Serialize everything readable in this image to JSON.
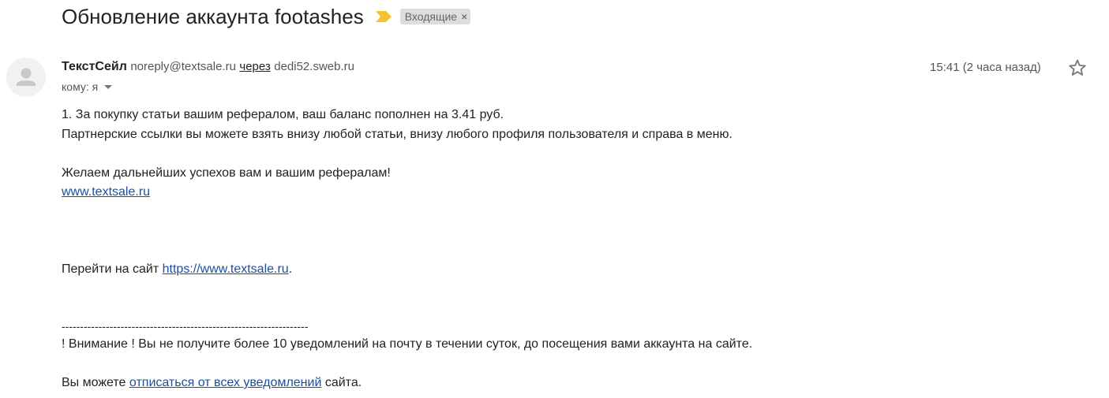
{
  "email": {
    "subject": "Обновление аккаунта footashes",
    "label": "Входящие",
    "label_close": "×",
    "sender": {
      "name": "ТекстСейл",
      "email": "noreply@textsale.ru",
      "via_label": "через",
      "via_host": "dedi52.sweb.ru"
    },
    "to_label": "кому: я",
    "time": "15:41 (2 часа назад)",
    "body": {
      "line1": "1. За покупку статьи вашим рефералом, ваш баланс пополнен на 3.41 руб.",
      "line2": "Партнерские ссылки вы можете взять внизу любой статьи, внизу любого профиля пользователя и справа в меню.",
      "line3": "Желаем дальнейших успехов вам и вашим рефералам!",
      "link1": "www.textsale.ru",
      "goto_prefix": "Перейти на сайт ",
      "goto_link": "https://www.textsale.ru",
      "goto_suffix": ".",
      "separator": "-------------------------------------------------------------------",
      "warning": "! Внимание ! Вы не получите более 10 уведомлений на почту в течении суток, до посещения вами аккаунта на сайте.",
      "unsub_prefix": "Вы можете ",
      "unsub_link": "отписаться от всех уведомлений",
      "unsub_suffix": " сайта."
    }
  },
  "icons": {
    "importance": "importance-marker-icon",
    "avatar": "default-avatar-icon",
    "caret": "chevron-down-icon",
    "star": "star-icon"
  },
  "colors": {
    "importance": "#f4c430",
    "link": "#1a4fa0",
    "label_bg": "#dddddd"
  }
}
